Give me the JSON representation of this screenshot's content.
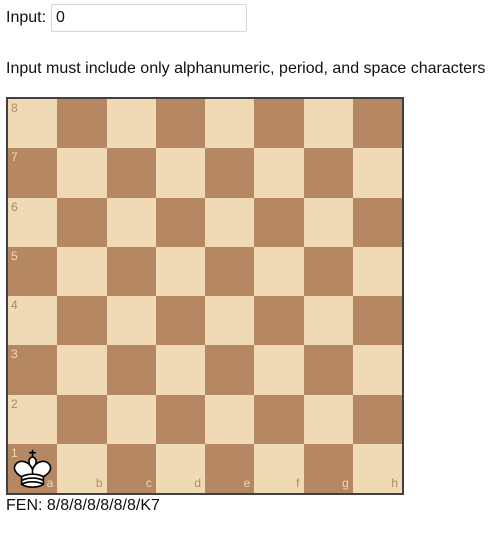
{
  "input": {
    "label": "Input:",
    "value": "0"
  },
  "validation_message": "Input must include only alphanumeric, period, and space characters",
  "board": {
    "ranks": [
      "8",
      "7",
      "6",
      "5",
      "4",
      "3",
      "2",
      "1"
    ],
    "files": [
      "a",
      "b",
      "c",
      "d",
      "e",
      "f",
      "g",
      "h"
    ],
    "light_color": "#f0d9b5",
    "dark_color": "#b58863",
    "pieces": [
      {
        "square": "a1",
        "piece": "white-king",
        "icon": "white-king-icon"
      }
    ]
  },
  "fen": {
    "label": "FEN:",
    "value": "8/8/8/8/8/8/8/K7"
  }
}
